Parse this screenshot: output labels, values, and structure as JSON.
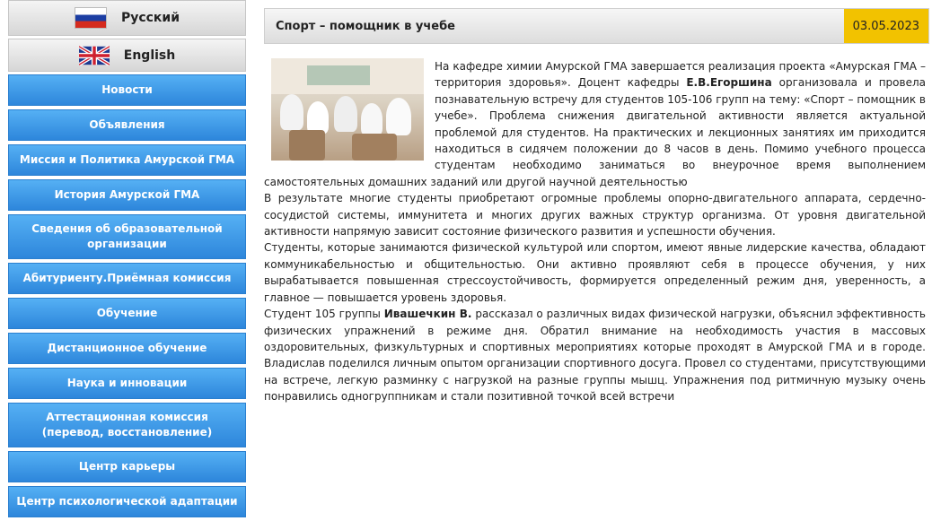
{
  "sidebar": {
    "languages": [
      {
        "label": "Русский",
        "flag": "ru-flag-icon"
      },
      {
        "label": "English",
        "flag": "uk-flag-icon"
      }
    ],
    "items": [
      "Новости",
      "Объявления",
      "Миссия и Политика Амурской ГМА",
      "История Амурской ГМА",
      "Сведения об образовательной организации",
      "Абитуриенту.Приёмная комиссия",
      "Обучение",
      "Дистанционное обучение",
      "Наука и инновации",
      "Аттестационная комиссия (перевод, восстановление)",
      "Центр карьеры",
      "Центр психологической адаптации"
    ]
  },
  "article": {
    "title": "Спорт – помощник в учебе",
    "date": "03.05.2023",
    "paragraphs": [
      {
        "a": "На кафедре химии Амурской ГМА завершается реализация проекта «Амурская ГМА – территория здоровья». Доцент кафедры ",
        "bold": "Е.В.Егоршина",
        "b": " организовала и провела познавательную встречу для студентов 105-106 групп на тему: «Спорт – помощник в учебе». Проблема снижения двигательной активности является актуальной проблемой для студентов. На практических и лекционных занятиях им приходится находиться в сидячем положении до 8 часов в день. Помимо учебного процесса студентам необходимо заниматься во внеурочное время выполнением самостоятельных домашних заданий или другой научной деятельностью"
      },
      {
        "a": "В результате многие студенты приобретают огромные проблемы опорно-двигательного аппарата, сердечно-сосудистой системы, иммунитета и многих других важных структур организма. От уровня двигательной активности напрямую зависит состояние физического развития и успешности обучения."
      },
      {
        "a": "Студенты, которые занимаются физической культурой или спортом, имеют явные лидерские качества, обладают коммуникабельностью и общительностью. Они активно проявляют себя в процессе обучения, у них вырабатывается повышенная стрессоустойчивость, формируется определенный режим дня, уверенность, а главное — повышается уровень здоровья."
      },
      {
        "a": "Студент 105 группы ",
        "bold": "Ивашечкин В.",
        "b": " рассказал о различных видах физической нагрузки, объяснил эффективность физических упражнений в режиме дня. Обратил внимание на необходимость участия в массовых оздоровительных, физкультурных и спортивных мероприятиях которые проходят в Амурской ГМА и в городе. Владислав поделился личным опытом организации спортивного досуга. Провел со студентами, присутствующими на встрече, легкую разминку с нагрузкой на разные группы мышц. Упражнения под ритмичную музыку очень понравились одногруппникам и стали позитивной точкой всей встречи"
      }
    ]
  }
}
